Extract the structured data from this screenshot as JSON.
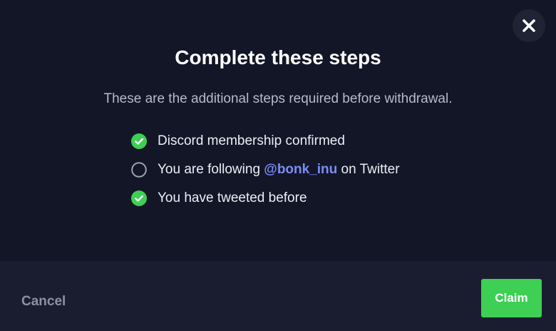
{
  "dialog": {
    "title": "Complete these steps",
    "subtitle": "These are the additional steps required before withdrawal.",
    "close_icon": "close-icon"
  },
  "steps": [
    {
      "text": "Discord membership confirmed",
      "done": true
    },
    {
      "text_before": "You are following ",
      "handle": "@bonk_inu",
      "text_after": " on Twitter",
      "done": false
    },
    {
      "text": "You have tweeted before",
      "done": true
    }
  ],
  "footer": {
    "cancel_label": "Cancel",
    "claim_label": "Claim"
  },
  "colors": {
    "background": "#131627",
    "footer_background": "#1a1d2f",
    "check_green": "#3ecf55",
    "handle_link": "#7b8cf6",
    "claim_button": "#3ecf55"
  }
}
